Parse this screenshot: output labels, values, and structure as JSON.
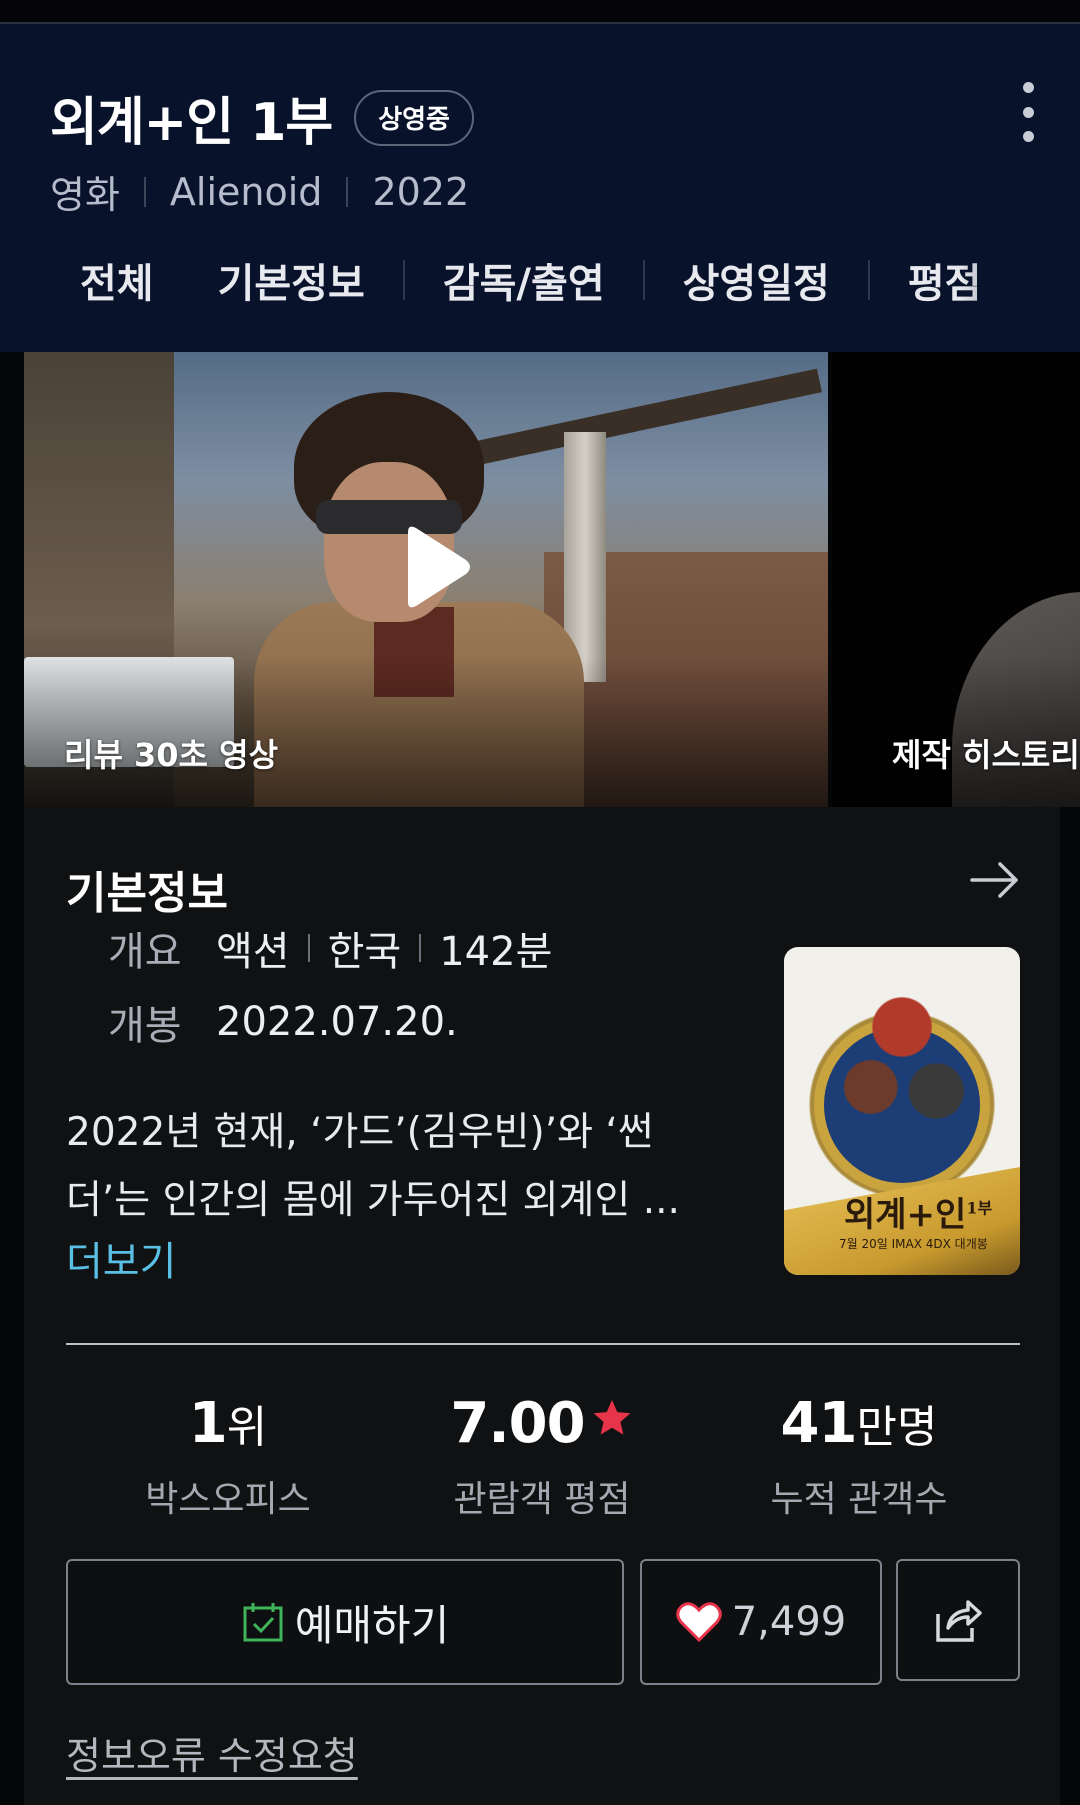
{
  "header": {
    "title": "외계+인 1부",
    "badge": "상영중",
    "meta": [
      "영화",
      "Alienoid",
      "2022"
    ],
    "tabs": [
      "전체",
      "기본정보",
      "감독/출연",
      "상영일정",
      "평점"
    ]
  },
  "media": {
    "clips": [
      {
        "label": "리뷰 30초 영상",
        "icon": "play-icon"
      },
      {
        "label": "제작 히스토리"
      }
    ]
  },
  "basic_info": {
    "section_title": "기본정보",
    "overview_label": "개요",
    "genre": "액션",
    "country": "한국",
    "runtime": "142분",
    "release_label": "개봉",
    "release_date": "2022.07.20.",
    "synopsis": "2022년 현재, ‘가드’(김우빈)’와 ‘썬더’는 인간의 몸에 가두어진 외계인 ...",
    "more": "더보기",
    "poster": {
      "title": "외계+인",
      "title_sup": "1부",
      "caption": "7월 20일 IMAX 4DX 대개봉"
    }
  },
  "stats": [
    {
      "value": "1",
      "unit": "위",
      "label": "박스오피스"
    },
    {
      "value": "7.00",
      "unit": "",
      "label": "관람객 평점",
      "icon": "star-icon"
    },
    {
      "value": "41",
      "unit": "만명",
      "label": "누적 관객수"
    }
  ],
  "actions": {
    "reserve": "예매하기",
    "likes": "7,499",
    "share_icon": "share-icon"
  },
  "footer": {
    "report": "정보오류 수정요청"
  },
  "colors": {
    "header_bg": "#08122b",
    "accent_link": "#59bfe4",
    "star": "#e8344a",
    "check": "#3fb55a"
  }
}
